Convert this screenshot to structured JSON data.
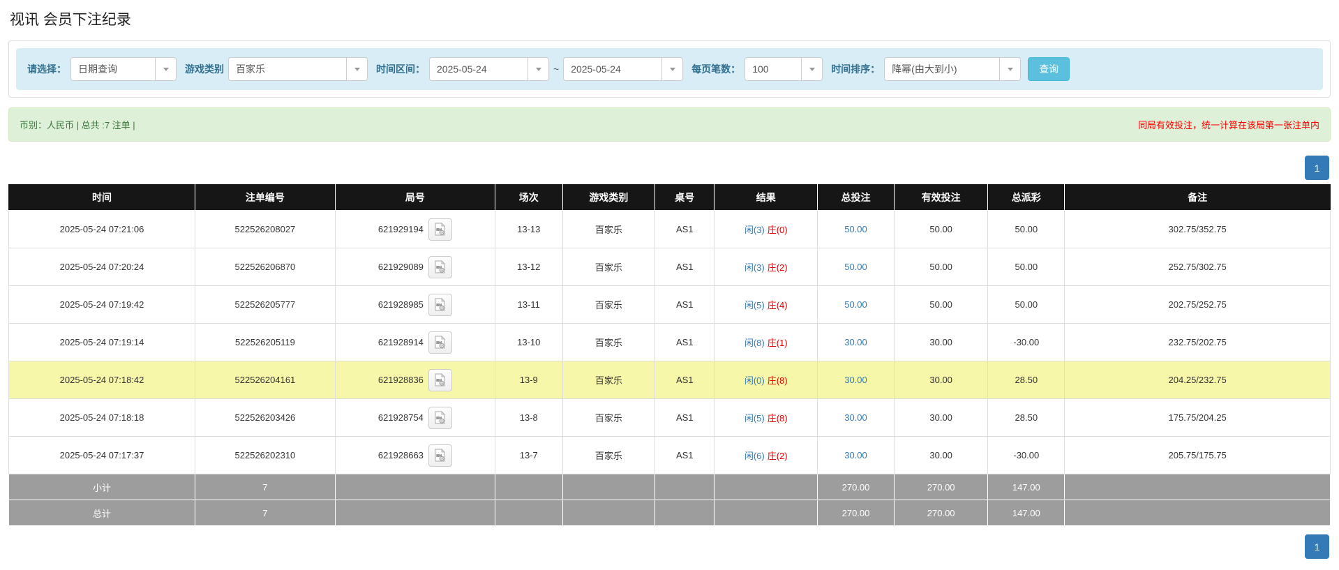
{
  "page_title": "视讯 会员下注纪录",
  "filters": {
    "select_label": "请选择：",
    "select_value": "日期查询",
    "game_type_label": "游戏类别",
    "game_type_value": "百家乐",
    "time_range_label": "时间区间：",
    "date_from": "2025-05-24",
    "tilde": "~",
    "date_to": "2025-05-24",
    "page_size_label": "每页笔数：",
    "page_size_value": "100",
    "sort_label": "时间排序：",
    "sort_value": "降幂(由大到小)",
    "search_button": "查询"
  },
  "summary": {
    "left": "币别：人民币 | 总共 :7 注单 |",
    "right": "同局有效投注，统一计算在该局第一张注单内"
  },
  "pagination": {
    "page": "1"
  },
  "table": {
    "headers": [
      "时间",
      "注单编号",
      "局号",
      "场次",
      "游戏类别",
      "桌号",
      "结果",
      "总投注",
      "有效投注",
      "总派彩",
      "备注"
    ],
    "rows": [
      {
        "time": "2025-05-24 07:21:06",
        "bet_id": "522526208027",
        "round_id": "621929194",
        "session": "13-13",
        "game": "百家乐",
        "table_no": "AS1",
        "result_player": "闲(3)",
        "result_banker": "庄(0)",
        "total_bet": "50.00",
        "valid_bet": "50.00",
        "payout": "50.00",
        "remark": "302.75/352.75",
        "highlight": false
      },
      {
        "time": "2025-05-24 07:20:24",
        "bet_id": "522526206870",
        "round_id": "621929089",
        "session": "13-12",
        "game": "百家乐",
        "table_no": "AS1",
        "result_player": "闲(3)",
        "result_banker": "庄(2)",
        "total_bet": "50.00",
        "valid_bet": "50.00",
        "payout": "50.00",
        "remark": "252.75/302.75",
        "highlight": false
      },
      {
        "time": "2025-05-24 07:19:42",
        "bet_id": "522526205777",
        "round_id": "621928985",
        "session": "13-11",
        "game": "百家乐",
        "table_no": "AS1",
        "result_player": "闲(5)",
        "result_banker": "庄(4)",
        "total_bet": "50.00",
        "valid_bet": "50.00",
        "payout": "50.00",
        "remark": "202.75/252.75",
        "highlight": false
      },
      {
        "time": "2025-05-24 07:19:14",
        "bet_id": "522526205119",
        "round_id": "621928914",
        "session": "13-10",
        "game": "百家乐",
        "table_no": "AS1",
        "result_player": "闲(8)",
        "result_banker": "庄(1)",
        "total_bet": "30.00",
        "valid_bet": "30.00",
        "payout": "-30.00",
        "remark": "232.75/202.75",
        "highlight": false
      },
      {
        "time": "2025-05-24 07:18:42",
        "bet_id": "522526204161",
        "round_id": "621928836",
        "session": "13-9",
        "game": "百家乐",
        "table_no": "AS1",
        "result_player": "闲(0)",
        "result_banker": "庄(8)",
        "total_bet": "30.00",
        "valid_bet": "30.00",
        "payout": "28.50",
        "remark": "204.25/232.75",
        "highlight": true
      },
      {
        "time": "2025-05-24 07:18:18",
        "bet_id": "522526203426",
        "round_id": "621928754",
        "session": "13-8",
        "game": "百家乐",
        "table_no": "AS1",
        "result_player": "闲(5)",
        "result_banker": "庄(8)",
        "total_bet": "30.00",
        "valid_bet": "30.00",
        "payout": "28.50",
        "remark": "175.75/204.25",
        "highlight": false
      },
      {
        "time": "2025-05-24 07:17:37",
        "bet_id": "522526202310",
        "round_id": "621928663",
        "session": "13-7",
        "game": "百家乐",
        "table_no": "AS1",
        "result_player": "闲(6)",
        "result_banker": "庄(2)",
        "total_bet": "30.00",
        "valid_bet": "30.00",
        "payout": "-30.00",
        "remark": "205.75/175.75",
        "highlight": false
      }
    ],
    "footer": [
      {
        "label": "小计",
        "count": "7",
        "total_bet": "270.00",
        "valid_bet": "270.00",
        "payout": "147.00"
      },
      {
        "label": "总计",
        "count": "7",
        "total_bet": "270.00",
        "valid_bet": "270.00",
        "payout": "147.00"
      }
    ]
  },
  "icons": [
    "chevron-down-icon",
    "video-file-icon"
  ],
  "colors": {
    "accent_blue": "#337ab7",
    "search_button_bg": "#5bc0de",
    "filter_bar_bg": "#d9edf7",
    "filter_label": "#31708f",
    "summary_bg": "#dff0d8",
    "summary_text": "#3c763d",
    "note_red": "#ff0000",
    "banker_red": "#e60000",
    "negative_red": "#e60000",
    "highlight_yellow": "#f7f7aa",
    "table_header_bg": "#161616",
    "table_footer_bg": "#9d9d9d"
  }
}
